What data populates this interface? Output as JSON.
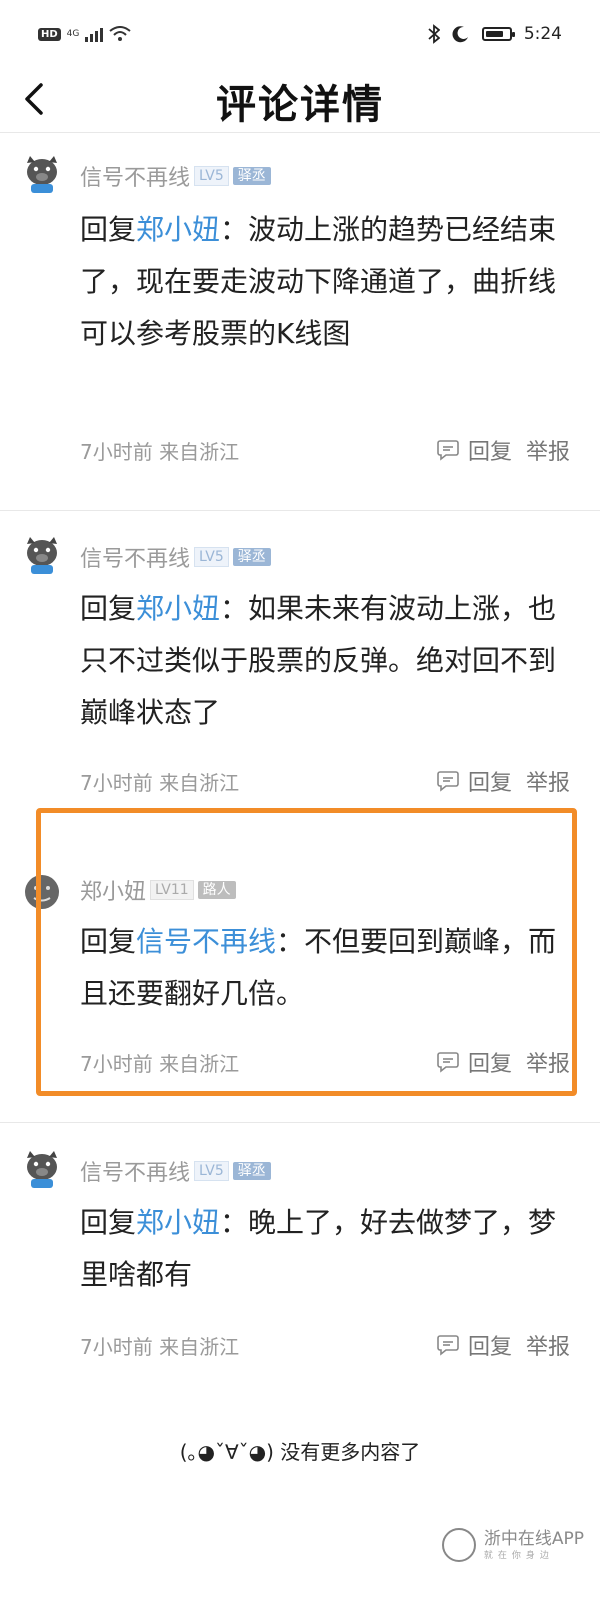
{
  "status_bar": {
    "hd": "HD",
    "network": "4G",
    "time": "5:24",
    "battery_level": 0.75
  },
  "header": {
    "title": "评论详情"
  },
  "comments": [
    {
      "user": "信号不再线",
      "level": "LV5",
      "tag": "驿丞",
      "reply_prefix": "回复",
      "reply_to": "郑小妞",
      "separator": "：",
      "text": "波动上涨的趋势已经结束了，现在要走波动下降通道了，曲折线可以参考股票的K线图",
      "meta": "7小时前 来自浙江",
      "reply_label": "回复",
      "report_label": "举报"
    },
    {
      "user": "信号不再线",
      "level": "LV5",
      "tag": "驿丞",
      "reply_prefix": "回复",
      "reply_to": "郑小妞",
      "separator": "：",
      "text": "如果未来有波动上涨，也只不过类似于股票的反弹。绝对回不到巅峰状态了",
      "meta": "7小时前 来自浙江",
      "reply_label": "回复",
      "report_label": "举报"
    },
    {
      "user": "郑小妞",
      "level": "LV11",
      "tag": "路人",
      "reply_prefix": "回复",
      "reply_to": "信号不再线",
      "separator": "：",
      "text": "不但要回到巅峰，而且还要翻好几倍。",
      "meta": "7小时前 来自浙江",
      "reply_label": "回复",
      "report_label": "举报"
    },
    {
      "user": "信号不再线",
      "level": "LV5",
      "tag": "驿丞",
      "reply_prefix": "回复",
      "reply_to": "郑小妞",
      "separator": "：",
      "text": "晚上了，好去做梦了，梦里啥都有",
      "meta": "7小时前 来自浙江",
      "reply_label": "回复",
      "report_label": "举报"
    }
  ],
  "footer": {
    "end_text": "(｡◕ˇ∀ˇ◕) 没有更多内容了"
  },
  "watermark": {
    "name": "浙中在线APP",
    "sub": "就在你身边"
  },
  "colors": {
    "mention": "#3c8fd8",
    "highlight": "#f28c28",
    "meta": "#9a9a9a"
  }
}
